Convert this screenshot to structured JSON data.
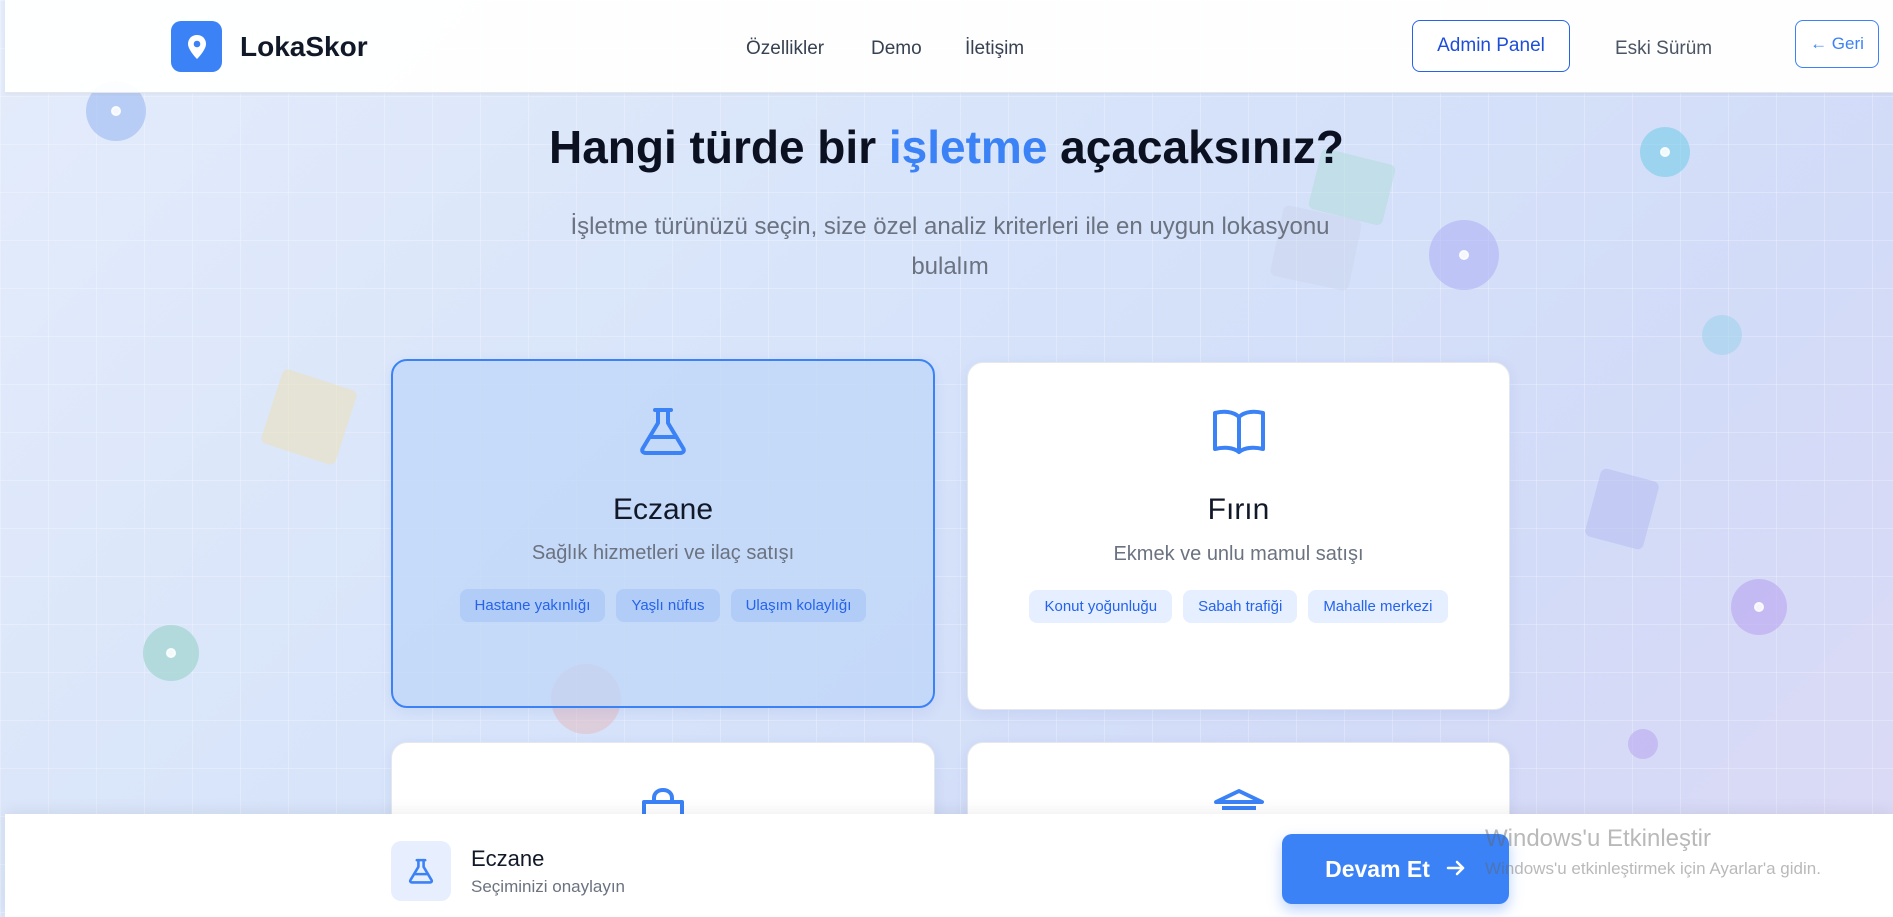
{
  "header": {
    "logo_text": "LokaSkor",
    "nav": [
      "Özellikler",
      "Demo",
      "İletişim"
    ],
    "admin_button": "Admin Panel",
    "old_version_link": "Eski Sürüm",
    "back_button": "← Geri"
  },
  "hero": {
    "title_before": "Hangi türde bir ",
    "title_accent": "işletme",
    "title_after": " açacaksınız?",
    "subtitle": "İşletme türünüzü seçin, size özel analiz kriterleri ile en uygun lokasyonu bulalım"
  },
  "cards": [
    {
      "icon": "flask-icon",
      "title": "Eczane",
      "description": "Sağlık hizmetleri ve ilaç satışı",
      "tags": [
        "Hastane yakınlığı",
        "Yaşlı nüfus",
        "Ulaşım kolaylığı"
      ],
      "selected": true
    },
    {
      "icon": "book-open-icon",
      "title": "Fırın",
      "description": "Ekmek ve unlu mamul satışı",
      "tags": [
        "Konut yoğunluğu",
        "Sabah trafiği",
        "Mahalle merkezi"
      ],
      "selected": false
    },
    {
      "icon": "shopping-bag-icon",
      "selected": false
    },
    {
      "icon": "bank-icon",
      "selected": false
    }
  ],
  "footer": {
    "selected_icon": "flask-icon",
    "selected_name": "Eczane",
    "selected_hint": "Seçiminizi onaylayın",
    "continue_button": "Devam Et"
  },
  "watermark": {
    "title": "Windows'u Etkinleştir",
    "subtitle": "Windows'u etkinleştirmek için Ayarlar'a gidin."
  },
  "colors": {
    "accent": "#3b82f6",
    "text_dark": "#111827",
    "text_muted": "#6b7280"
  }
}
